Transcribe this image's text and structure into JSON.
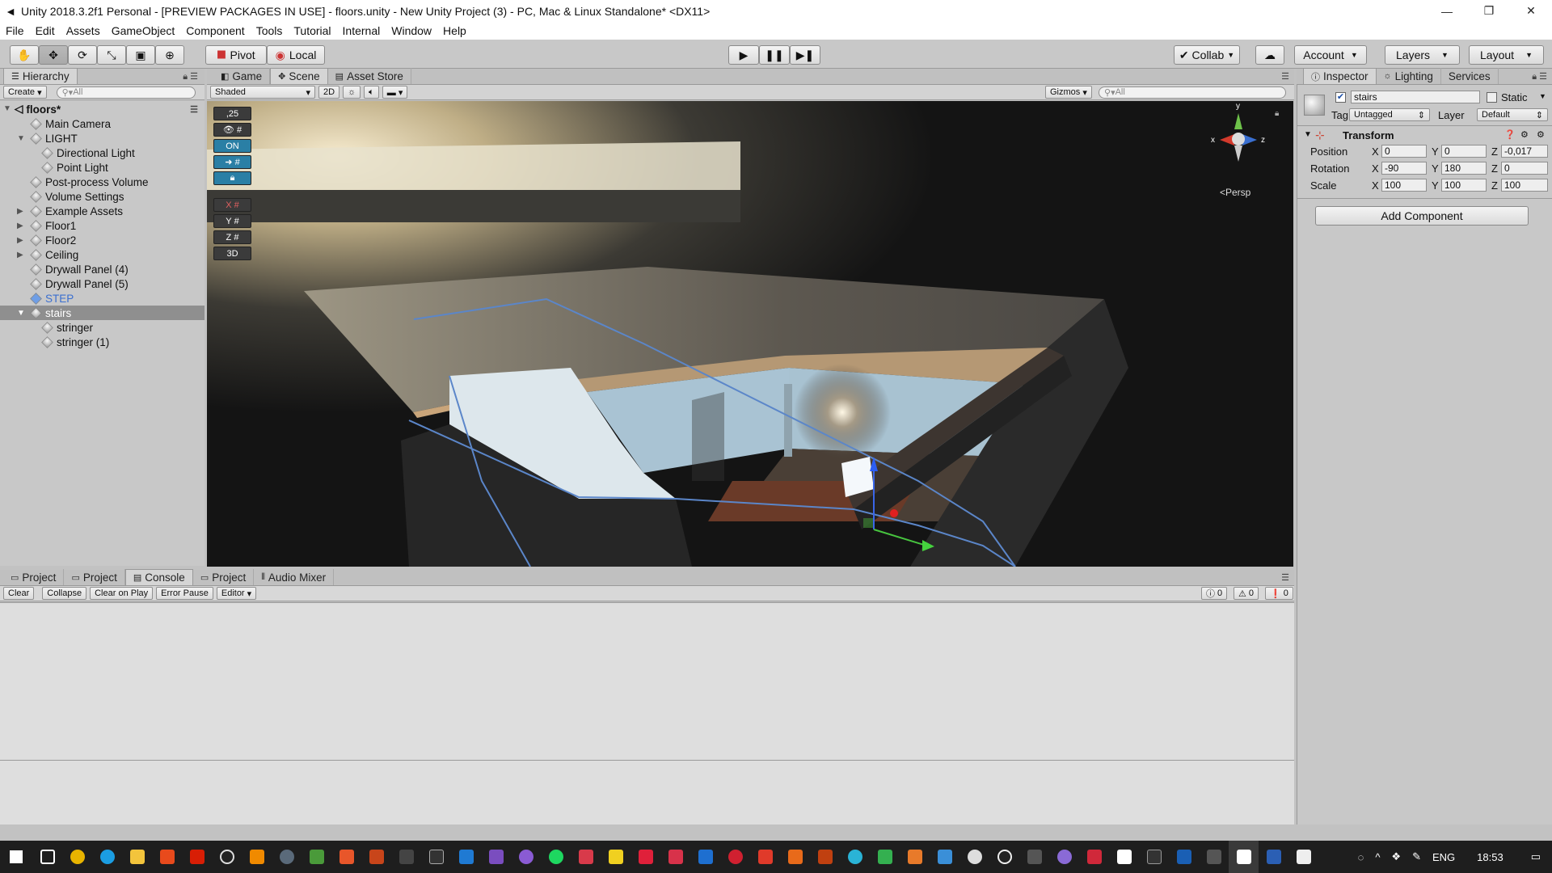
{
  "window": {
    "title": "Unity 2018.3.2f1 Personal - [PREVIEW PACKAGES IN USE] - floors.unity - New Unity Project (3) - PC, Mac & Linux Standalone* <DX11>"
  },
  "menu": [
    "File",
    "Edit",
    "Assets",
    "GameObject",
    "Component",
    "Tools",
    "Tutorial",
    "Internal",
    "Window",
    "Help"
  ],
  "toolbar": {
    "pivot": "Pivot",
    "local": "Local",
    "collab": "Collab",
    "account": "Account",
    "layers": "Layers",
    "layout": "Layout"
  },
  "hierarchy": {
    "tab": "Hierarchy",
    "create": "Create",
    "search_placeholder": "All",
    "scene": "floors*",
    "items": [
      {
        "label": "Main Camera"
      },
      {
        "label": "LIGHT"
      },
      {
        "label": "Directional Light"
      },
      {
        "label": "Point Light"
      },
      {
        "label": "Post-process Volume"
      },
      {
        "label": "Volume Settings"
      },
      {
        "label": "Example Assets"
      },
      {
        "label": "Floor1"
      },
      {
        "label": "Floor2"
      },
      {
        "label": "Ceiling"
      },
      {
        "label": "Drywall Panel (4)"
      },
      {
        "label": "Drywall Panel (5)"
      },
      {
        "label": "STEP"
      },
      {
        "label": "stairs"
      },
      {
        "label": "stringer"
      },
      {
        "label": "stringer (1)"
      }
    ]
  },
  "scene_view": {
    "tabs": [
      "Game",
      "Scene",
      "Asset Store"
    ],
    "shading": "Shaded",
    "mode_2d": "2D",
    "gizmos": "Gizmos",
    "search_placeholder": "All",
    "tools": [
      ",25",
      "ON",
      "3D"
    ],
    "persp": "<Persp",
    "axis_x": "x",
    "axis_y": "y",
    "axis_z": "z",
    "grid_x": "X",
    "grid_y": "Y",
    "grid_z": "Z"
  },
  "console": {
    "tabs": [
      "Project",
      "Project",
      "Console",
      "Project",
      "Audio Mixer"
    ],
    "buttons": [
      "Clear",
      "Collapse",
      "Clear on Play",
      "Error Pause",
      "Editor"
    ],
    "counts": [
      "0",
      "0",
      "0"
    ]
  },
  "inspector": {
    "tabs": [
      "Inspector",
      "Lighting",
      "Services"
    ],
    "object_name": "stairs",
    "static_label": "Static",
    "tag_label": "Tag",
    "tag_value": "Untagged",
    "layer_label": "Layer",
    "layer_value": "Default",
    "transform_title": "Transform",
    "rows": [
      {
        "label": "Position",
        "x": "0",
        "y": "0",
        "z": "-0,017"
      },
      {
        "label": "Rotation",
        "x": "-90",
        "y": "180",
        "z": "0"
      },
      {
        "label": "Scale",
        "x": "100",
        "y": "100",
        "z": "100"
      }
    ],
    "axis_x": "X",
    "axis_y": "Y",
    "axis_z": "Z",
    "add_component": "Add Component"
  },
  "taskbar": {
    "lang": "ENG",
    "time": "18:53"
  }
}
